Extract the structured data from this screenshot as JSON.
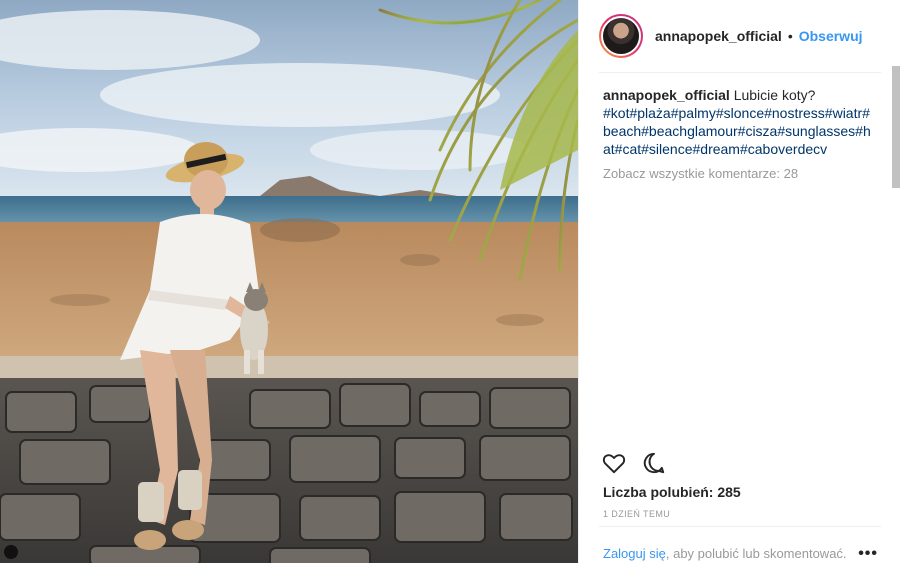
{
  "post": {
    "username": "annapopek_official",
    "separator": "•",
    "follow_label": "Obserwuj",
    "caption_text": "Lubicie koty?",
    "hashtags": "#kot#plaża#palmy#slonce#nostress#wiatr#beach#beachglamour#cisza#sunglasses#hat#cat#silence#dream#caboverdecv",
    "view_comments": "Zobacz wszystkie komentarze: 28",
    "likes": "Liczba polubień: 285",
    "time": "1 dzień temu",
    "login_link": "Zaloguj się",
    "login_rest": ", aby polubić lub skomentować.",
    "more": "•••"
  },
  "icons": [
    "heart-icon",
    "comment-icon",
    "more-options-icon"
  ],
  "colors": {
    "link_blue": "#3897f0",
    "hashtag_blue": "#003569",
    "muted_gray": "#999999",
    "text": "#262626"
  }
}
